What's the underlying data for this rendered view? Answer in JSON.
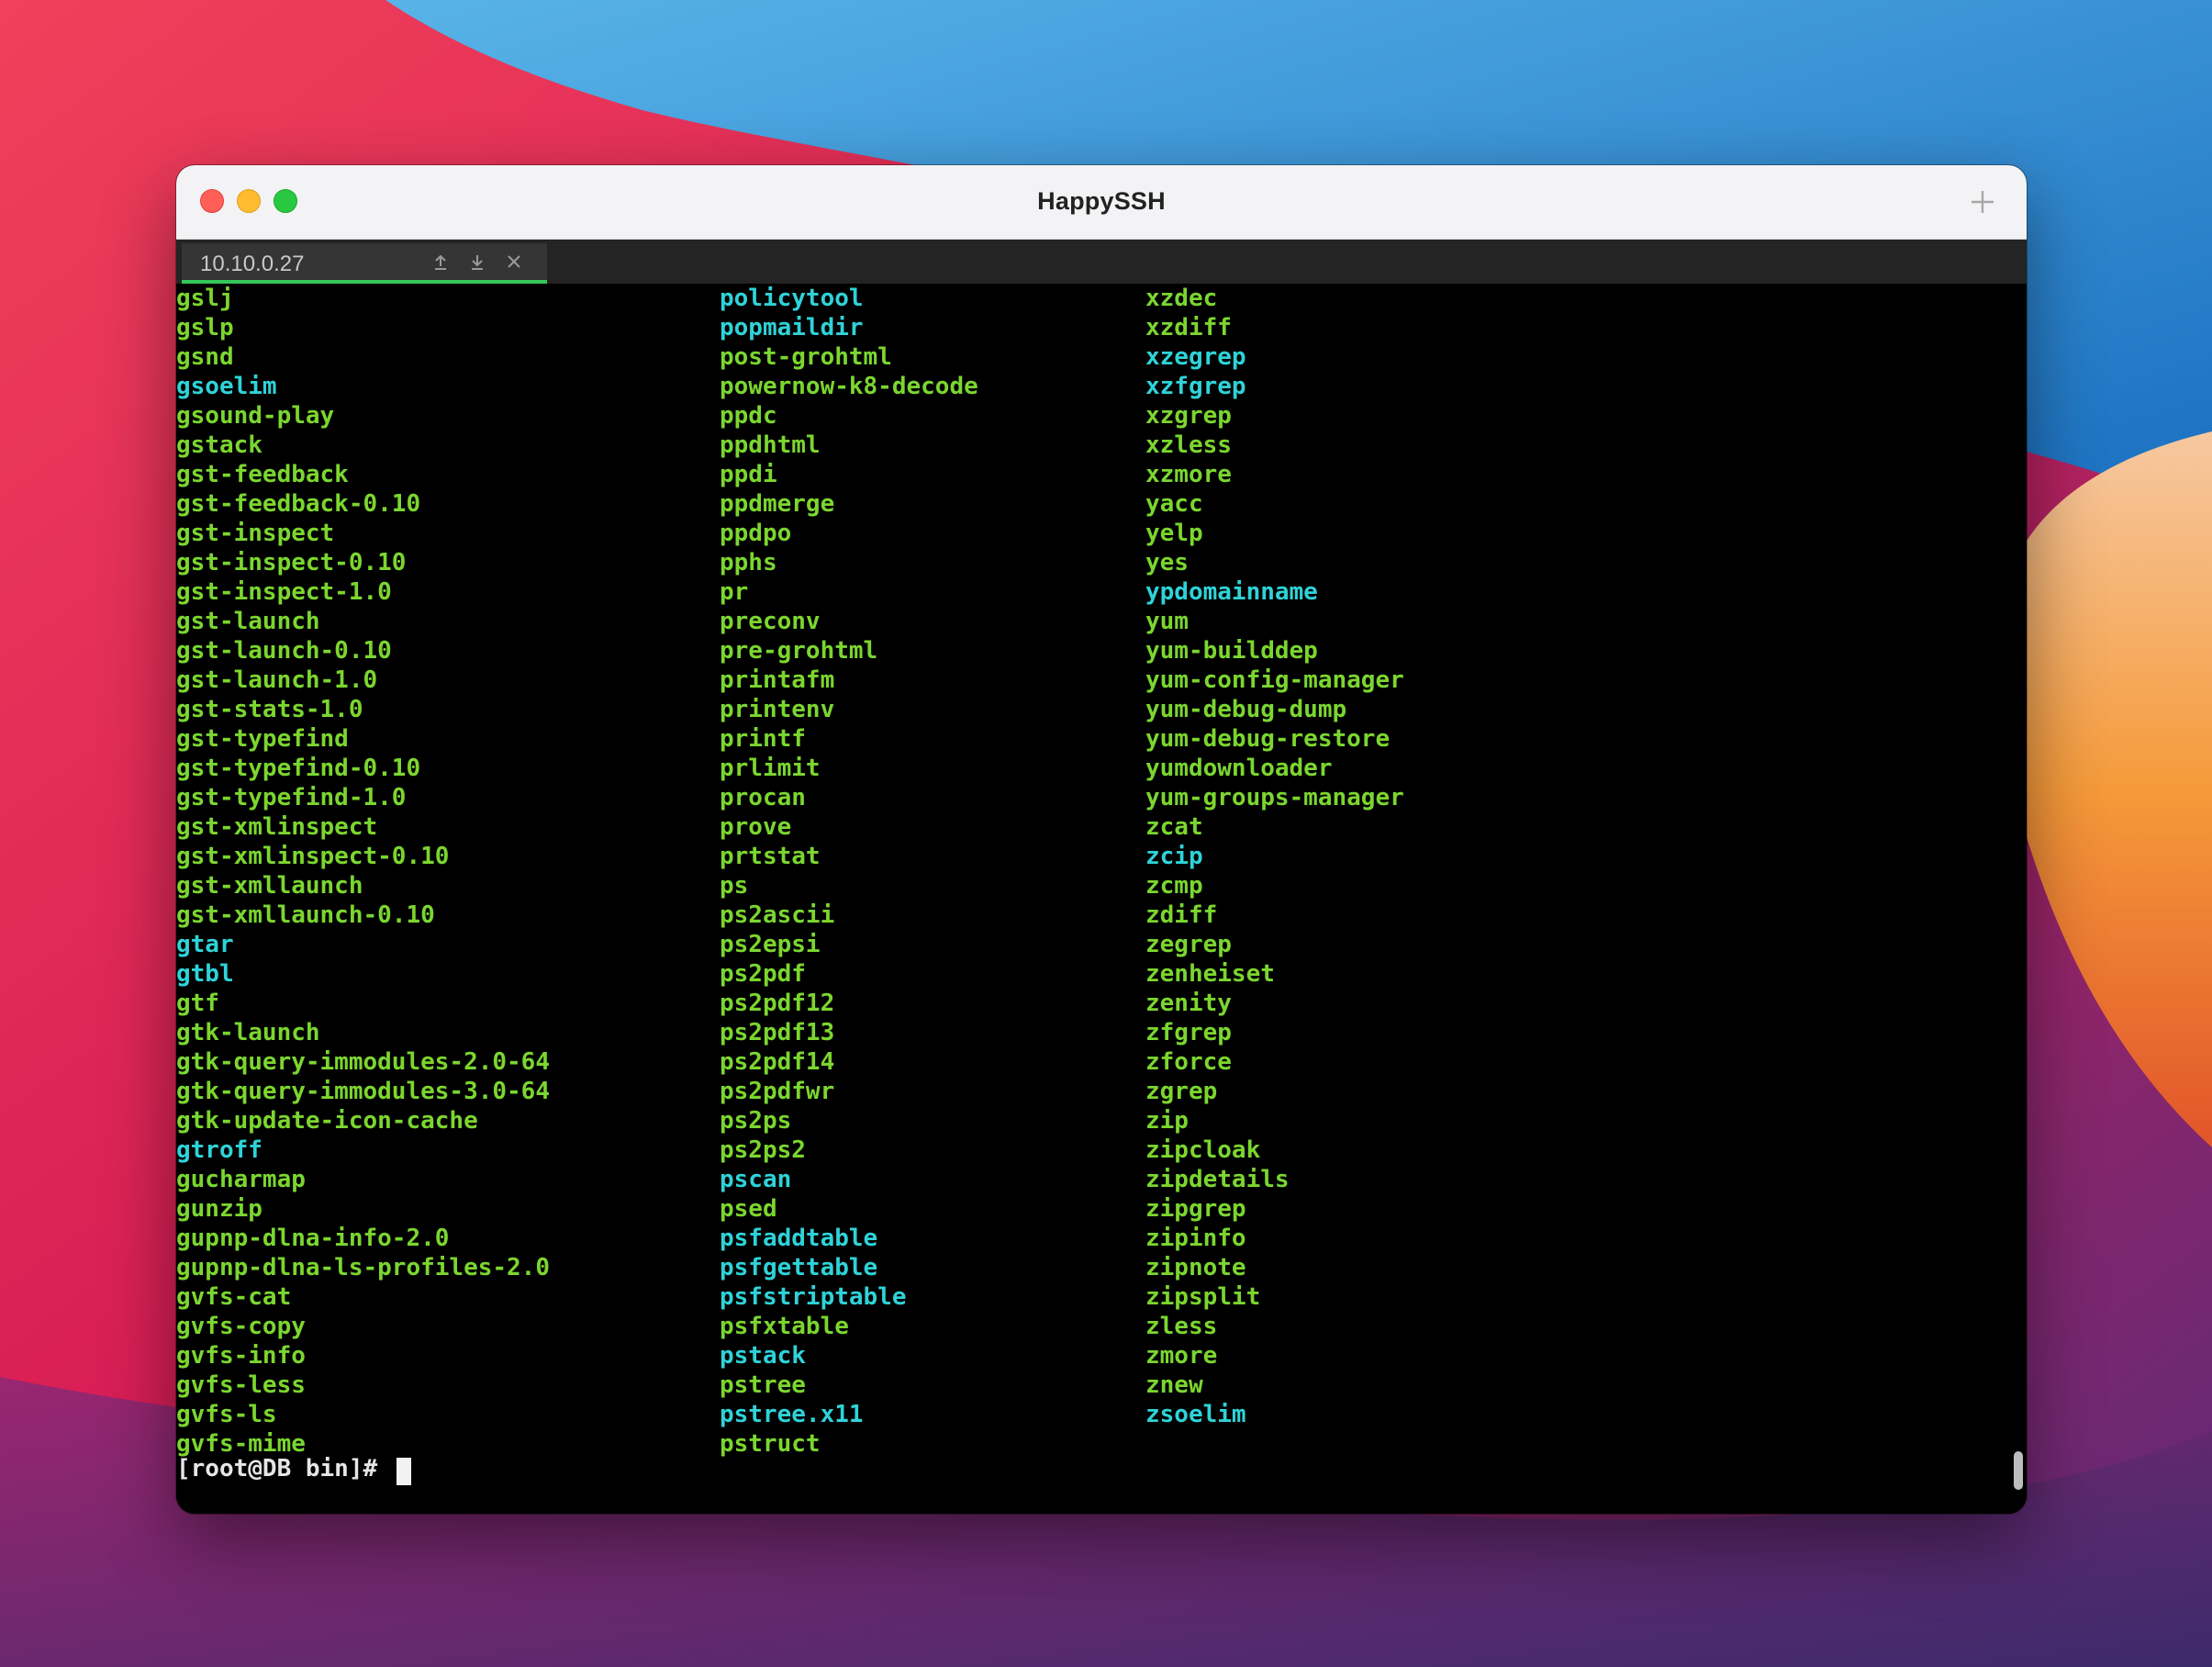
{
  "window": {
    "title": "HappySSH",
    "tab": {
      "label": "10.10.0.27",
      "upload_icon": "upload-icon",
      "download_icon": "download-icon",
      "close_icon": "close-icon"
    }
  },
  "colors": {
    "executable": "#7bd62f",
    "link": "#2ed3d8",
    "tab_active": "#34c759"
  },
  "terminal": {
    "columns": [
      [
        {
          "t": "gslj",
          "k": "g"
        },
        {
          "t": "gslp",
          "k": "g"
        },
        {
          "t": "gsnd",
          "k": "g"
        },
        {
          "t": "gsoelim",
          "k": "c"
        },
        {
          "t": "gsound-play",
          "k": "g"
        },
        {
          "t": "gstack",
          "k": "g"
        },
        {
          "t": "gst-feedback",
          "k": "g"
        },
        {
          "t": "gst-feedback-0.10",
          "k": "g"
        },
        {
          "t": "gst-inspect",
          "k": "g"
        },
        {
          "t": "gst-inspect-0.10",
          "k": "g"
        },
        {
          "t": "gst-inspect-1.0",
          "k": "g"
        },
        {
          "t": "gst-launch",
          "k": "g"
        },
        {
          "t": "gst-launch-0.10",
          "k": "g"
        },
        {
          "t": "gst-launch-1.0",
          "k": "g"
        },
        {
          "t": "gst-stats-1.0",
          "k": "g"
        },
        {
          "t": "gst-typefind",
          "k": "g"
        },
        {
          "t": "gst-typefind-0.10",
          "k": "g"
        },
        {
          "t": "gst-typefind-1.0",
          "k": "g"
        },
        {
          "t": "gst-xmlinspect",
          "k": "g"
        },
        {
          "t": "gst-xmlinspect-0.10",
          "k": "g"
        },
        {
          "t": "gst-xmllaunch",
          "k": "g"
        },
        {
          "t": "gst-xmllaunch-0.10",
          "k": "g"
        },
        {
          "t": "gtar",
          "k": "c"
        },
        {
          "t": "gtbl",
          "k": "c"
        },
        {
          "t": "gtf",
          "k": "g"
        },
        {
          "t": "gtk-launch",
          "k": "g"
        },
        {
          "t": "gtk-query-immodules-2.0-64",
          "k": "g"
        },
        {
          "t": "gtk-query-immodules-3.0-64",
          "k": "g"
        },
        {
          "t": "gtk-update-icon-cache",
          "k": "g"
        },
        {
          "t": "gtroff",
          "k": "c"
        },
        {
          "t": "gucharmap",
          "k": "g"
        },
        {
          "t": "gunzip",
          "k": "g"
        },
        {
          "t": "gupnp-dlna-info-2.0",
          "k": "g"
        },
        {
          "t": "gupnp-dlna-ls-profiles-2.0",
          "k": "g"
        },
        {
          "t": "gvfs-cat",
          "k": "g"
        },
        {
          "t": "gvfs-copy",
          "k": "g"
        },
        {
          "t": "gvfs-info",
          "k": "g"
        },
        {
          "t": "gvfs-less",
          "k": "g"
        },
        {
          "t": "gvfs-ls",
          "k": "g"
        },
        {
          "t": "gvfs-mime",
          "k": "g"
        }
      ],
      [
        {
          "t": "policytool",
          "k": "c"
        },
        {
          "t": "popmaildir",
          "k": "c"
        },
        {
          "t": "post-grohtml",
          "k": "g"
        },
        {
          "t": "powernow-k8-decode",
          "k": "g"
        },
        {
          "t": "ppdc",
          "k": "g"
        },
        {
          "t": "ppdhtml",
          "k": "g"
        },
        {
          "t": "ppdi",
          "k": "g"
        },
        {
          "t": "ppdmerge",
          "k": "g"
        },
        {
          "t": "ppdpo",
          "k": "g"
        },
        {
          "t": "pphs",
          "k": "g"
        },
        {
          "t": "pr",
          "k": "g"
        },
        {
          "t": "preconv",
          "k": "g"
        },
        {
          "t": "pre-grohtml",
          "k": "g"
        },
        {
          "t": "printafm",
          "k": "g"
        },
        {
          "t": "printenv",
          "k": "g"
        },
        {
          "t": "printf",
          "k": "g"
        },
        {
          "t": "prlimit",
          "k": "g"
        },
        {
          "t": "procan",
          "k": "g"
        },
        {
          "t": "prove",
          "k": "g"
        },
        {
          "t": "prtstat",
          "k": "g"
        },
        {
          "t": "ps",
          "k": "g"
        },
        {
          "t": "ps2ascii",
          "k": "g"
        },
        {
          "t": "ps2epsi",
          "k": "g"
        },
        {
          "t": "ps2pdf",
          "k": "g"
        },
        {
          "t": "ps2pdf12",
          "k": "g"
        },
        {
          "t": "ps2pdf13",
          "k": "g"
        },
        {
          "t": "ps2pdf14",
          "k": "g"
        },
        {
          "t": "ps2pdfwr",
          "k": "g"
        },
        {
          "t": "ps2ps",
          "k": "g"
        },
        {
          "t": "ps2ps2",
          "k": "g"
        },
        {
          "t": "pscan",
          "k": "c"
        },
        {
          "t": "psed",
          "k": "g"
        },
        {
          "t": "psfaddtable",
          "k": "c"
        },
        {
          "t": "psfgettable",
          "k": "c"
        },
        {
          "t": "psfstriptable",
          "k": "c"
        },
        {
          "t": "psfxtable",
          "k": "g"
        },
        {
          "t": "pstack",
          "k": "c"
        },
        {
          "t": "pstree",
          "k": "g"
        },
        {
          "t": "pstree.x11",
          "k": "c"
        },
        {
          "t": "pstruct",
          "k": "g"
        }
      ],
      [
        {
          "t": "xzdec",
          "k": "g"
        },
        {
          "t": "xzdiff",
          "k": "g"
        },
        {
          "t": "xzegrep",
          "k": "c"
        },
        {
          "t": "xzfgrep",
          "k": "c"
        },
        {
          "t": "xzgrep",
          "k": "g"
        },
        {
          "t": "xzless",
          "k": "g"
        },
        {
          "t": "xzmore",
          "k": "g"
        },
        {
          "t": "yacc",
          "k": "g"
        },
        {
          "t": "yelp",
          "k": "g"
        },
        {
          "t": "yes",
          "k": "g"
        },
        {
          "t": "ypdomainname",
          "k": "c"
        },
        {
          "t": "yum",
          "k": "g"
        },
        {
          "t": "yum-builddep",
          "k": "g"
        },
        {
          "t": "yum-config-manager",
          "k": "g"
        },
        {
          "t": "yum-debug-dump",
          "k": "g"
        },
        {
          "t": "yum-debug-restore",
          "k": "g"
        },
        {
          "t": "yumdownloader",
          "k": "g"
        },
        {
          "t": "yum-groups-manager",
          "k": "g"
        },
        {
          "t": "zcat",
          "k": "g"
        },
        {
          "t": "zcip",
          "k": "c"
        },
        {
          "t": "zcmp",
          "k": "g"
        },
        {
          "t": "zdiff",
          "k": "g"
        },
        {
          "t": "zegrep",
          "k": "g"
        },
        {
          "t": "zenheiset",
          "k": "g"
        },
        {
          "t": "zenity",
          "k": "g"
        },
        {
          "t": "zfgrep",
          "k": "g"
        },
        {
          "t": "zforce",
          "k": "g"
        },
        {
          "t": "zgrep",
          "k": "g"
        },
        {
          "t": "zip",
          "k": "g"
        },
        {
          "t": "zipcloak",
          "k": "g"
        },
        {
          "t": "zipdetails",
          "k": "g"
        },
        {
          "t": "zipgrep",
          "k": "g"
        },
        {
          "t": "zipinfo",
          "k": "g"
        },
        {
          "t": "zipnote",
          "k": "g"
        },
        {
          "t": "zipsplit",
          "k": "g"
        },
        {
          "t": "zless",
          "k": "g"
        },
        {
          "t": "zmore",
          "k": "g"
        },
        {
          "t": "znew",
          "k": "g"
        },
        {
          "t": "zsoelim",
          "k": "c"
        }
      ]
    ],
    "prompt": "[root@DB bin]# "
  }
}
